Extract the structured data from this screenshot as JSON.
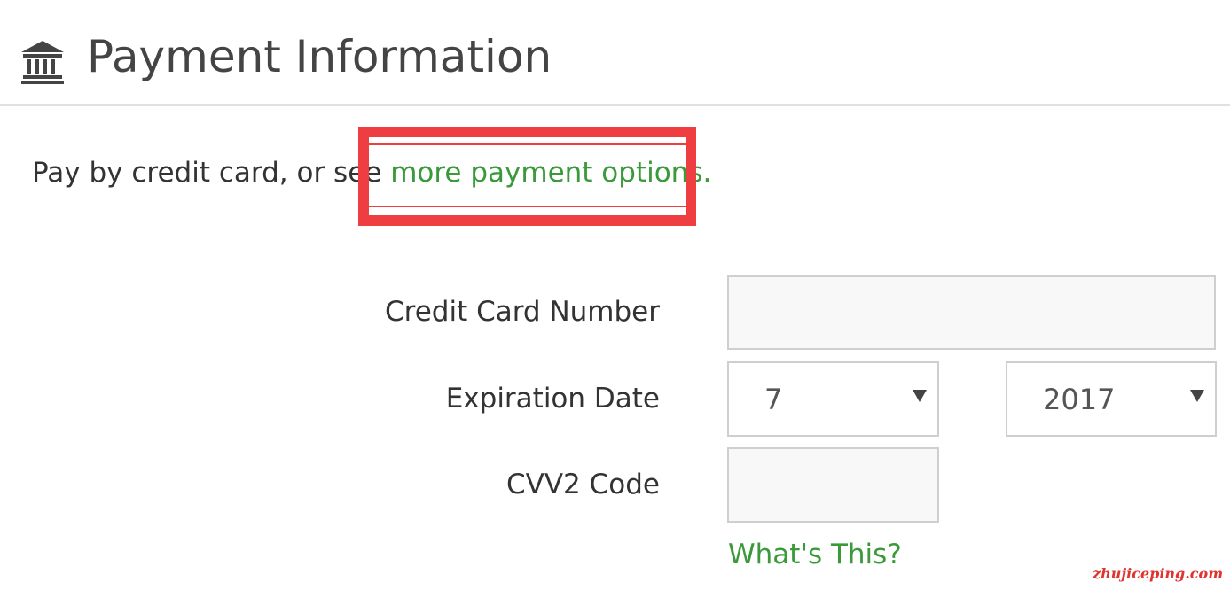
{
  "header": {
    "icon": "bank-icon",
    "title": "Payment Information"
  },
  "intro": {
    "text": "Pay by credit card, or see ",
    "link_label": "more payment options."
  },
  "form": {
    "credit_card": {
      "label": "Credit Card Number",
      "value": ""
    },
    "expiration": {
      "label": "Expiration Date",
      "month": "7",
      "year": "2017"
    },
    "cvv": {
      "label": "CVV2 Code",
      "value": "",
      "help_link": "What's This?"
    }
  },
  "watermark": "zhujiceping.com",
  "colors": {
    "link_green": "#3a9a3a",
    "highlight_red": "#ef3e42",
    "input_border": "#cfcfcf",
    "input_bg": "#f8f8f8"
  }
}
